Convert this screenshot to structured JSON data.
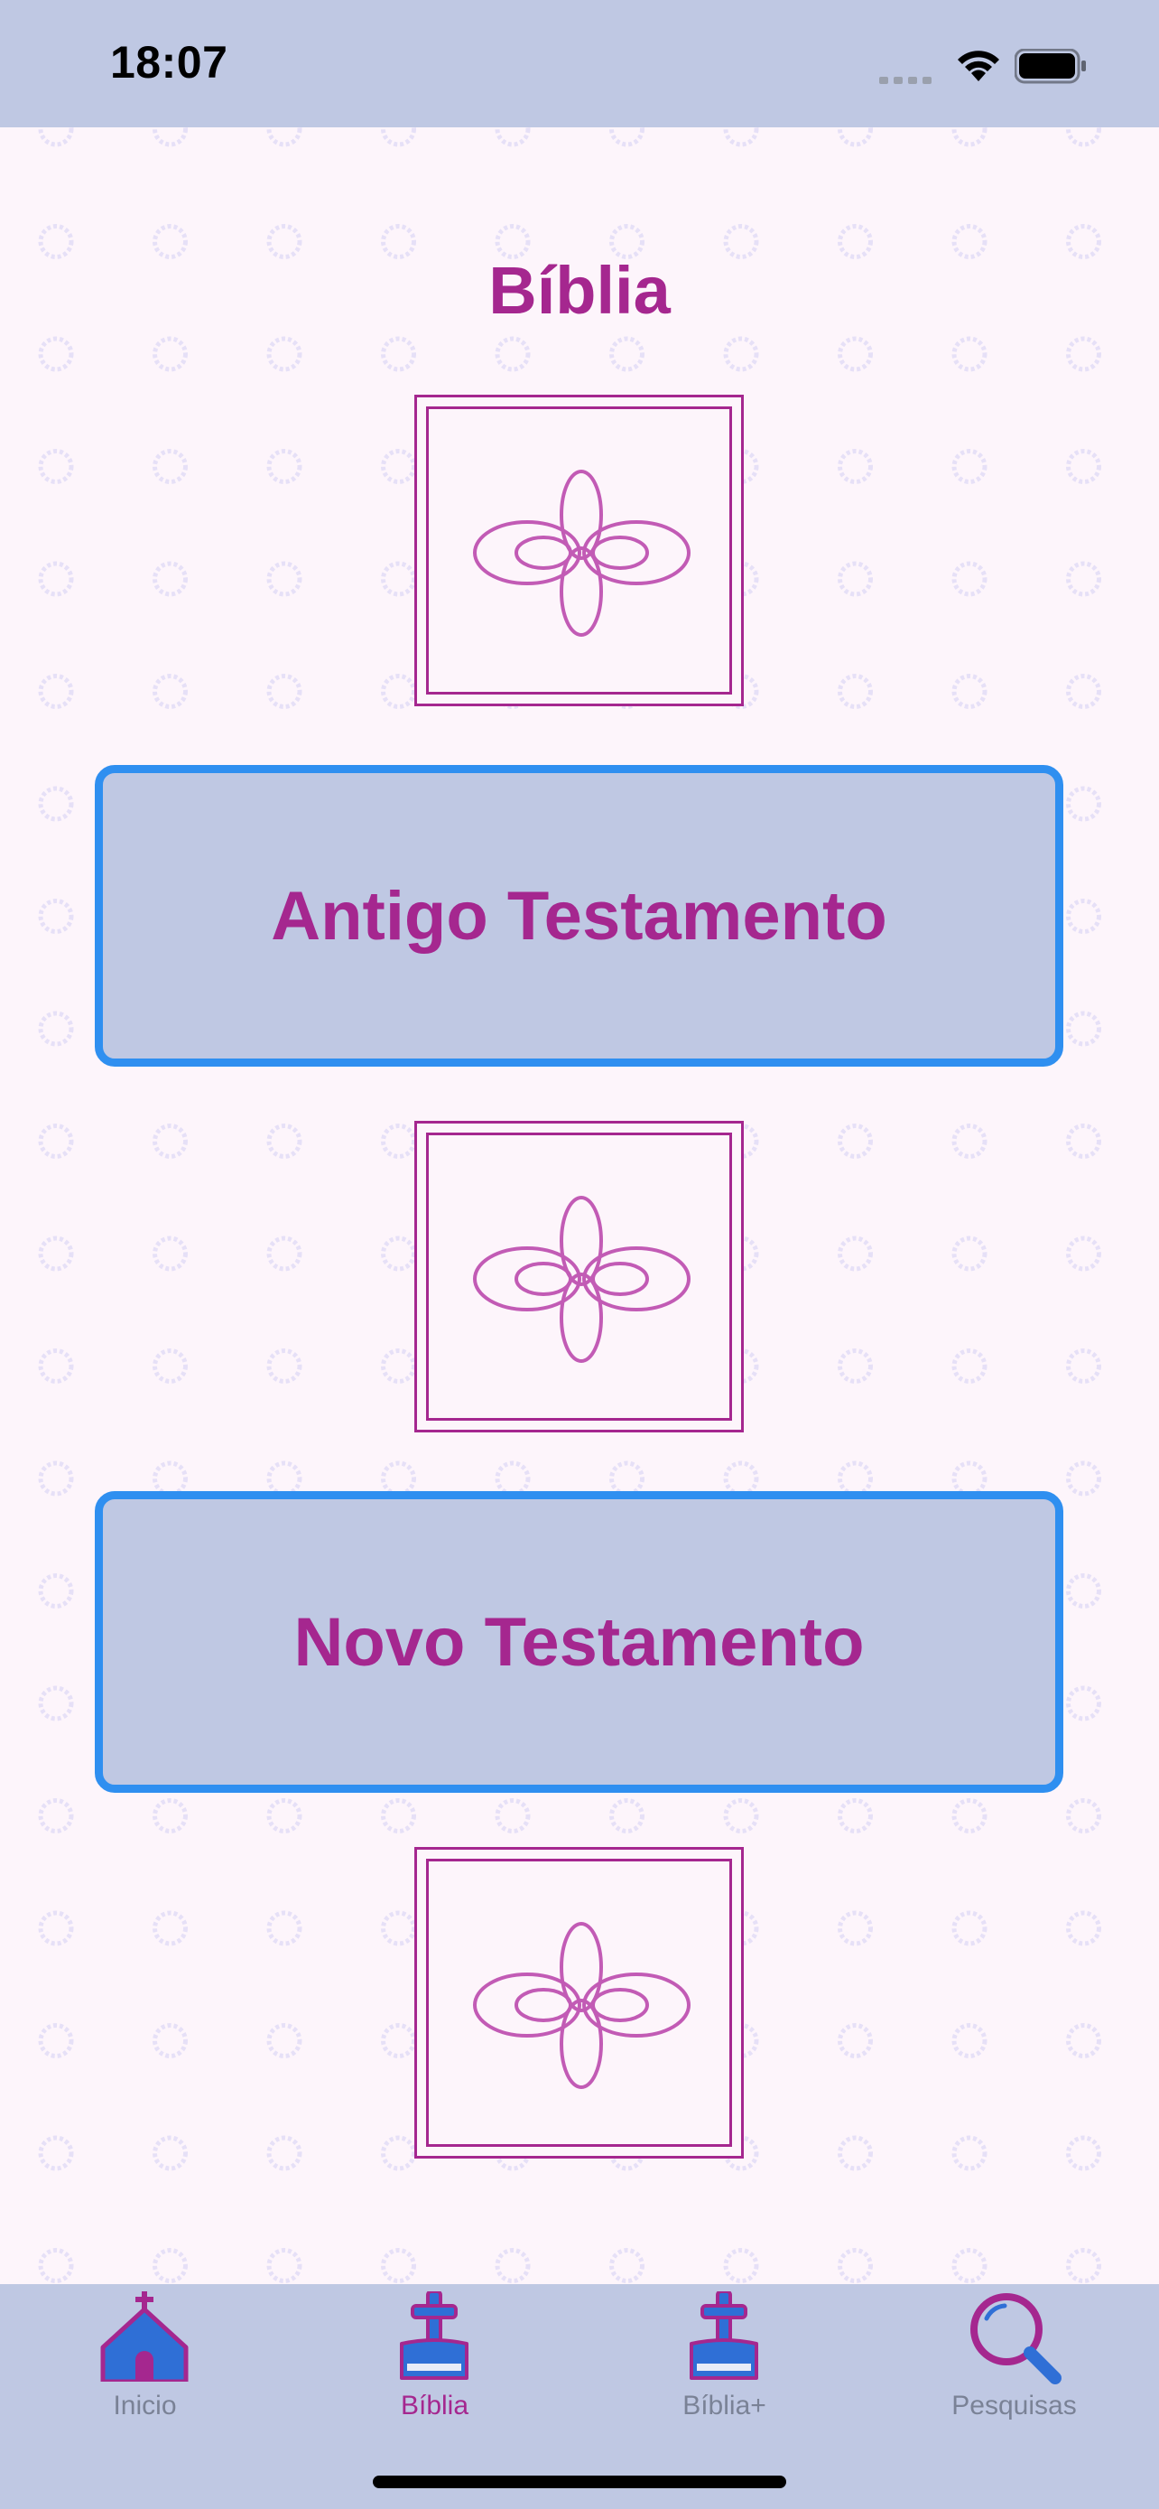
{
  "status_bar": {
    "time": "18:07"
  },
  "page": {
    "title": "Bíblia"
  },
  "buttons": {
    "old_testament": "Antigo Testamento",
    "new_testament": "Novo Testamento"
  },
  "tabs": [
    {
      "label": "Inicio",
      "icon": "church-icon",
      "active": false
    },
    {
      "label": "Bíblia",
      "icon": "bible-cross-icon",
      "active": true
    },
    {
      "label": "Bíblia+",
      "icon": "bible-cross-icon",
      "active": false
    },
    {
      "label": "Pesquisas",
      "icon": "magnifier-icon",
      "active": false
    }
  ],
  "colors": {
    "accent": "#a5278f",
    "button_border": "#2f8ff0",
    "bar_background": "#bfc8e3",
    "page_background": "#fdf5fb"
  }
}
